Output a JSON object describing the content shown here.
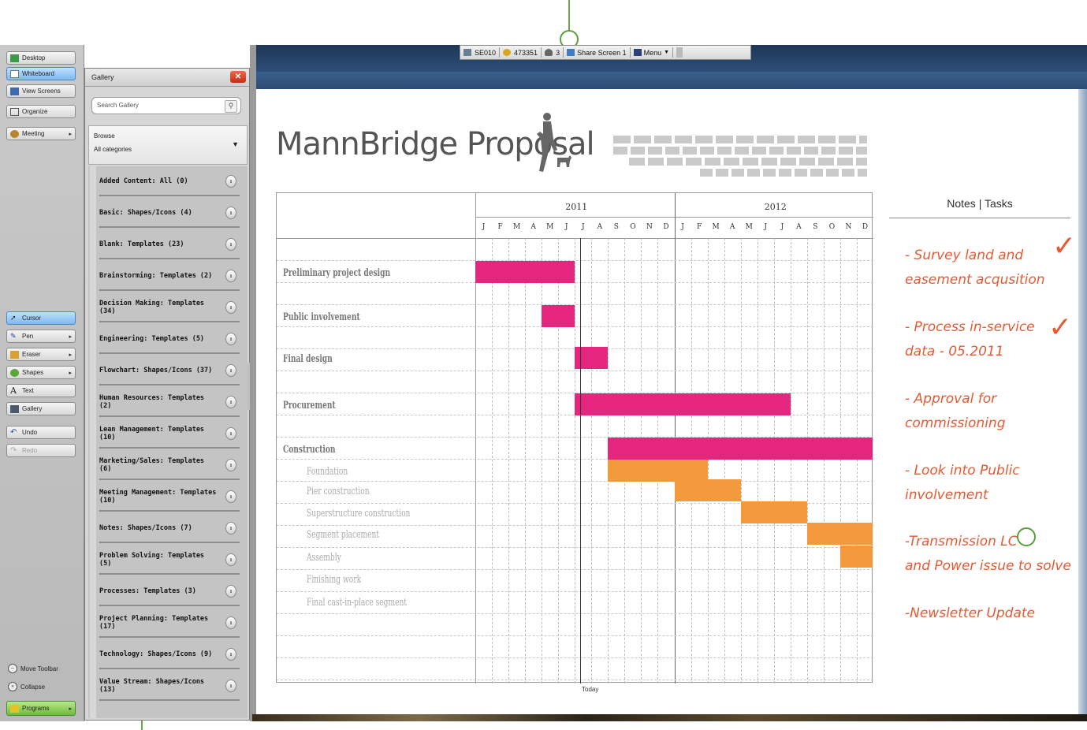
{
  "left_toolbar": {
    "items": [
      {
        "label": "Desktop"
      },
      {
        "label": "Whiteboard"
      },
      {
        "label": "View Screens"
      },
      {
        "label": "Organize"
      },
      {
        "label": "Meeting"
      }
    ],
    "tools": [
      {
        "label": "Cursor"
      },
      {
        "label": "Pen"
      },
      {
        "label": "Eraser"
      },
      {
        "label": "Shapes"
      },
      {
        "label": "Text"
      },
      {
        "label": "Gallery"
      }
    ],
    "undo": "Undo",
    "redo": "Redo",
    "move_toolbar": "Move Toolbar",
    "collapse": "Collapse",
    "programs": "Programs"
  },
  "gallery": {
    "title": "Gallery",
    "search_placeholder": "Search Gallery",
    "browse_label": "Browse",
    "browse_value": "All categories",
    "categories": [
      "Added Content: All (0)",
      "Basic: Shapes/Icons (4)",
      "Blank: Templates (23)",
      "Brainstorming: Templates (2)",
      "Decision Making: Templates (34)",
      "Engineering: Templates (5)",
      "Flowchart: Shapes/Icons (37)",
      "Human Resources: Templates (2)",
      "Lean Management: Templates (10)",
      "Marketing/Sales: Templates (6)",
      "Meeting Management: Templates (10)",
      "Notes: Shapes/Icons (7)",
      "Problem Solving: Templates (5)",
      "Processes: Templates (3)",
      "Project Planning: Templates (17)",
      "Technology: Shapes/Icons (9)",
      "Value Stream: Shapes/Icons (13)"
    ]
  },
  "session_bar": {
    "room": "SE010",
    "pin": "473351",
    "participants": "3",
    "share": "Share Screen 1",
    "menu": "Menu"
  },
  "document": {
    "title": "MannBridge Proposal",
    "gantt": {
      "years": [
        "2011",
        "2012"
      ],
      "months": [
        "J",
        "F",
        "M",
        "A",
        "M",
        "J",
        "J",
        "A",
        "S",
        "O",
        "N",
        "D",
        "J",
        "F",
        "M",
        "A",
        "M",
        "J",
        "J",
        "A",
        "S",
        "O",
        "N",
        "D"
      ],
      "today_label": "Today",
      "tasks": [
        {
          "name": "Preliminary project design",
          "type": "main"
        },
        {
          "name": "Public involvement",
          "type": "main"
        },
        {
          "name": "Final design",
          "type": "main"
        },
        {
          "name": "Procurement",
          "type": "main"
        },
        {
          "name": "Construction",
          "type": "main"
        },
        {
          "name": "Foundation",
          "type": "sub"
        },
        {
          "name": "Pier construction",
          "type": "sub"
        },
        {
          "name": "Superstructure construction",
          "type": "sub"
        },
        {
          "name": "Segment placement",
          "type": "sub"
        },
        {
          "name": "Assembly",
          "type": "sub"
        },
        {
          "name": "Finishing work",
          "type": "sub"
        },
        {
          "name": "Final cast-in-place segment",
          "type": "sub"
        }
      ],
      "colors": {
        "main": "#e5267e",
        "sub": "#f39b3c"
      }
    },
    "notes": {
      "title": "Notes | Tasks",
      "items": [
        {
          "line1": "- Survey land and",
          "line2": "easement acqusition"
        },
        {
          "line1": "- Process in-service",
          "line2": "data - 05.2011"
        },
        {
          "line1": "- Approval for",
          "line2": "commissioning"
        },
        {
          "line1": "- Look into Public",
          "line2": "involvement"
        },
        {
          "line1": "-Transmission LC",
          "line2": "and Power issue to solve"
        },
        {
          "line1": "-Newsletter Update",
          "line2": ""
        }
      ],
      "color": "#e65a33"
    }
  }
}
